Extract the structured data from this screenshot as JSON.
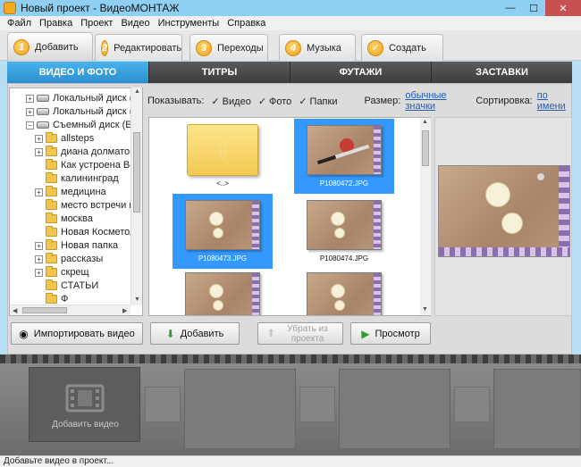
{
  "window": {
    "title": "Новый проект - ВидеоМОНТАЖ",
    "minimize": "—",
    "maximize": "☐",
    "close": "✕"
  },
  "menu": [
    "Файл",
    "Правка",
    "Проект",
    "Видео",
    "Инструменты",
    "Справка"
  ],
  "steps": [
    {
      "num": "1",
      "label": "Добавить",
      "active": true
    },
    {
      "num": "2",
      "label": "Редактировать"
    },
    {
      "num": "3",
      "label": "Переходы"
    },
    {
      "num": "4",
      "label": "Музыка"
    },
    {
      "num": "✓",
      "label": "Создать"
    }
  ],
  "categories": [
    "ВИДЕО И ФОТО",
    "ТИТРЫ",
    "ФУТАЖИ",
    "ЗАСТАВКИ"
  ],
  "tree": {
    "items": [
      {
        "label": "Локальный диск (C",
        "type": "drive",
        "exp": "+"
      },
      {
        "label": "Локальный диск (D",
        "type": "drive",
        "exp": "+"
      },
      {
        "label": "Съемный диск (E:)",
        "type": "drive",
        "exp": "−"
      },
      {
        "label": "allsteps",
        "type": "folder",
        "exp": "+"
      },
      {
        "label": "диана долматова",
        "type": "folder",
        "exp": "+"
      },
      {
        "label": "Как устроена Все",
        "type": "folder",
        "exp": ""
      },
      {
        "label": "калининград",
        "type": "folder",
        "exp": ""
      },
      {
        "label": "медицина",
        "type": "folder",
        "exp": "+"
      },
      {
        "label": "место встречи из",
        "type": "folder",
        "exp": ""
      },
      {
        "label": "москва",
        "type": "folder",
        "exp": ""
      },
      {
        "label": "Новая Косметолс",
        "type": "folder",
        "exp": ""
      },
      {
        "label": "Новая папка",
        "type": "folder",
        "exp": "+"
      },
      {
        "label": "рассказы",
        "type": "folder",
        "exp": "+"
      },
      {
        "label": "скрещ",
        "type": "folder",
        "exp": "+"
      },
      {
        "label": "СТАТЬИ",
        "type": "folder",
        "exp": ""
      },
      {
        "label": "Ф",
        "type": "folder",
        "exp": ""
      }
    ]
  },
  "filter": {
    "show_label": "Показывать:",
    "video": "Видео",
    "photo": "Фото",
    "folders": "Папки",
    "check": "✓",
    "size_label": "Размер:",
    "size_value": "обычные значки",
    "sort_label": "Сортировка:",
    "sort_value": "по имени"
  },
  "files": [
    {
      "name": "<..>",
      "type": "up",
      "selected": false
    },
    {
      "name": "P1080472.JPG",
      "type": "photo",
      "selected": true
    },
    {
      "name": "P1080473.JPG",
      "type": "photo",
      "selected": true
    },
    {
      "name": "P1080474.JPG",
      "type": "photo",
      "selected": false
    },
    {
      "name": "",
      "type": "photo",
      "selected": false
    },
    {
      "name": "",
      "type": "photo",
      "selected": false
    }
  ],
  "buttons": {
    "import": "Импортировать видео",
    "add": "Добавить",
    "remove": "Убрать из проекта",
    "preview": "Просмотр"
  },
  "timeline": {
    "add_video": "Добавить видео"
  },
  "status": "Добавьте видео в проект..."
}
